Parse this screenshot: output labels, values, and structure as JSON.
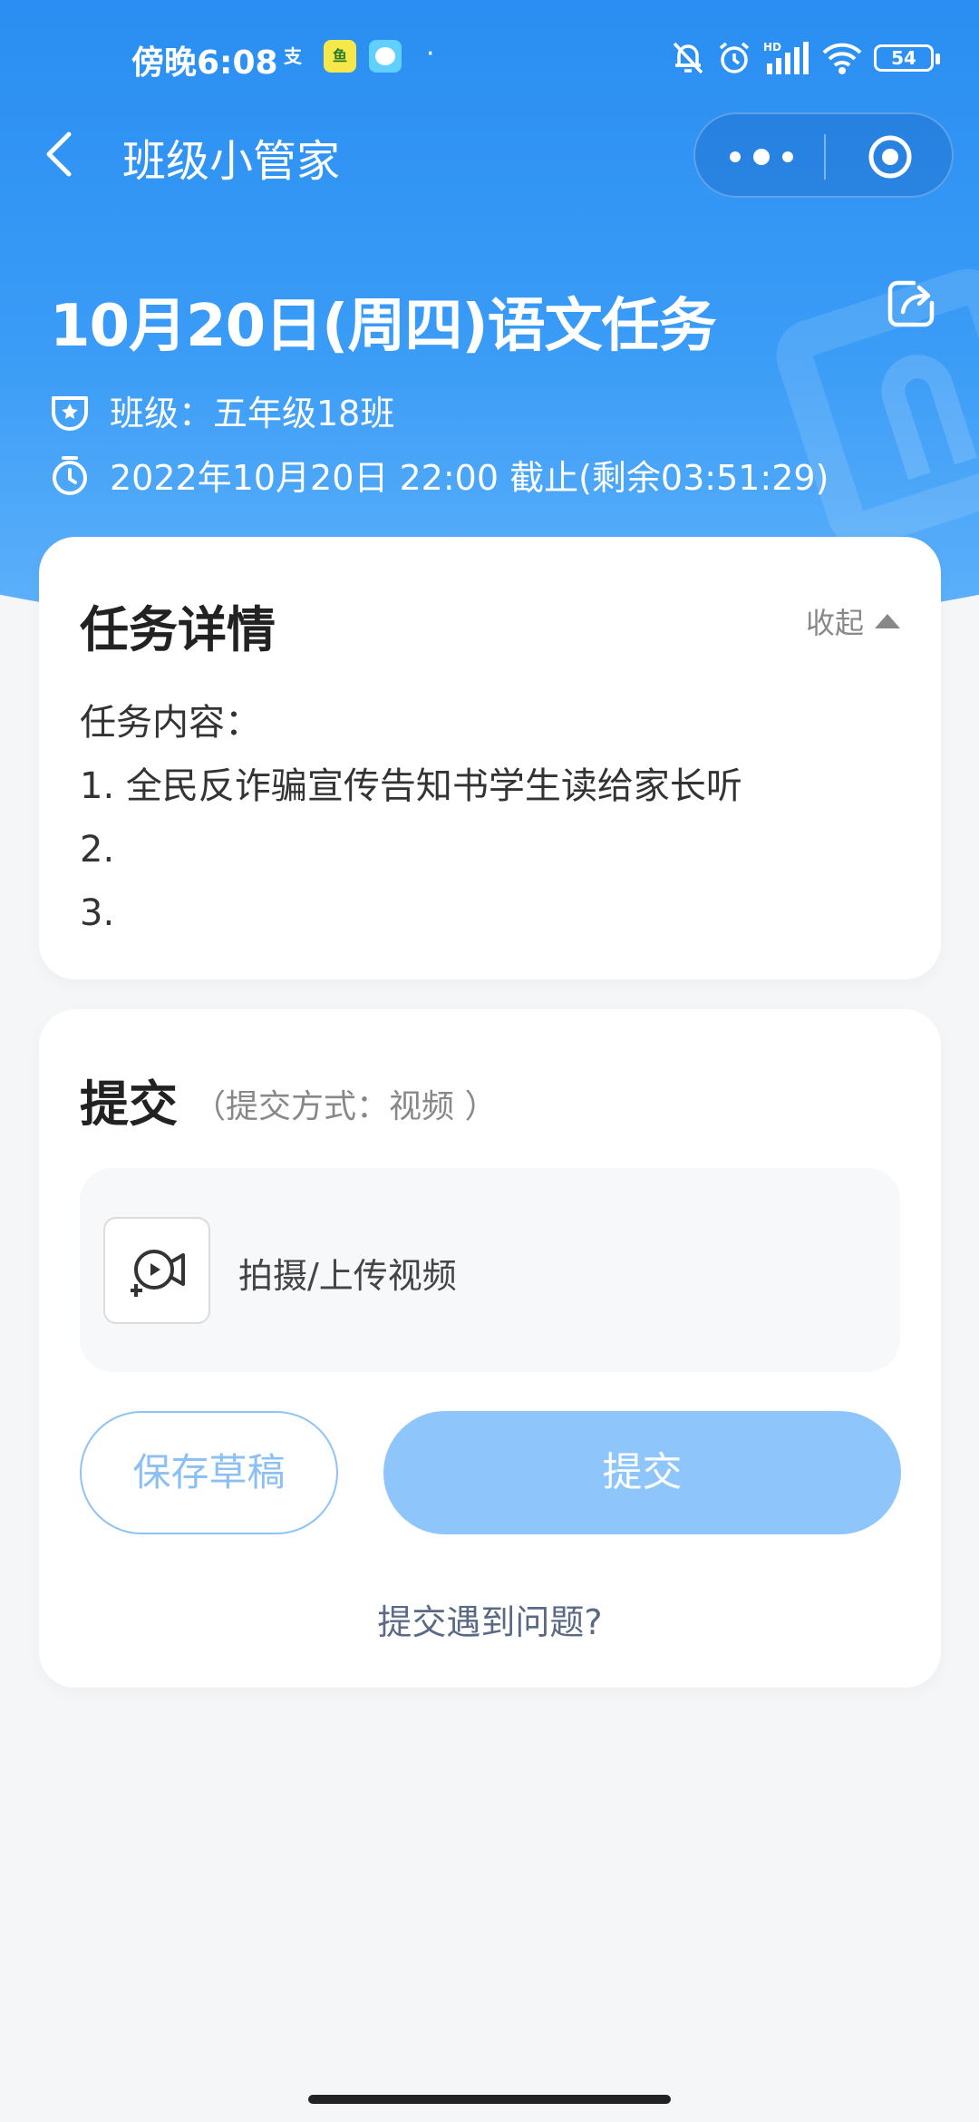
{
  "status_bar": {
    "time": "傍晚6:08",
    "battery": "54",
    "app_icons": [
      "alipay-icon",
      "fish-app-icon",
      "chat-app-icon"
    ],
    "badges": [
      "mute-icon",
      "alarm-icon",
      "hd-signal-icon",
      "wifi-icon"
    ]
  },
  "nav": {
    "title": "班级小管家"
  },
  "task": {
    "title": "10月20日(周四)语文任务",
    "class_label": "班级：五年级18班",
    "deadline": "2022年10月20日 22:00 截止(剩余03:51:29)"
  },
  "detail": {
    "title": "任务详情",
    "collapse_label": "收起",
    "lines": [
      "任务内容：",
      "1. 全民反诈骗宣传告知书学生读给家长听",
      "2.",
      "3."
    ]
  },
  "submit": {
    "title": "提交",
    "method": "（提交方式：视频 ）",
    "upload_label": "拍摄/上传视频",
    "draft_button": "保存草稿",
    "submit_button": "提交",
    "help_link": "提交遇到问题?"
  },
  "colors": {
    "header_blue": "#2a8ef2",
    "submit_button": "#8ec5fb",
    "draft_border": "#8fc3f5"
  }
}
